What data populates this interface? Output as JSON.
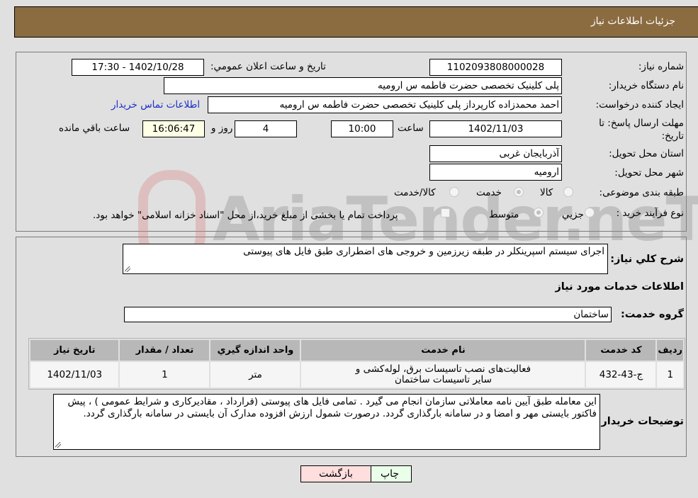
{
  "header": {
    "title": "جزئیات اطلاعات نیاز"
  },
  "fields": {
    "need_number": {
      "label": "شماره نیاز:",
      "value": "1102093808000028"
    },
    "announce_datetime": {
      "label": "تاریخ و ساعت اعلان عمومي:",
      "value": "1402/10/28 - 17:30"
    },
    "buyer_org": {
      "label": "نام دستگاه خريدار:",
      "value": "پلی کلینیک تخصصی حضرت فاطمه  س  ارومیه"
    },
    "requester": {
      "label": "ايجاد کننده درخواست:",
      "value": "احمد محمدزاده کارپرداز پلی کلینیک تخصصی حضرت فاطمه  س  ارومیه"
    },
    "buyer_contact_link": "اطلاعات تماس خریدار",
    "deadline": {
      "label": "مهلت ارسال پاسخ: تا تاریخ:",
      "date": "1402/11/03",
      "time_label": "ساعت",
      "time": "10:00",
      "days": "4",
      "days_label": "روز و",
      "remaining": "16:06:47",
      "remaining_label": "ساعت باقي مانده"
    },
    "province": {
      "label": "استان محل تحویل:",
      "value": "آذربایجان غربی"
    },
    "city": {
      "label": "شهر محل تحویل:",
      "value": "ارومیه"
    },
    "category": {
      "label": "طبقه بندی موضوعی:",
      "options": [
        "کالا",
        "خدمت",
        "کالا/خدمت"
      ],
      "selected": "خدمت"
    },
    "purchase_type": {
      "label": "نوع فرآیند خرید :",
      "options": [
        "جزيي",
        "متوسط"
      ],
      "selected": "متوسط",
      "treasury_note": "پرداخت تمام یا بخشی از مبلغ خرید،از محل \"اسناد خزانه اسلامی\" خواهد بود.",
      "treasury_checked": false
    }
  },
  "description": {
    "label": "شرح کلي نياز:",
    "value": "اجرای سیستم اسپرینکلر در طبقه زیرزمین و خروجی های اضطراری طبق فایل های پیوستی"
  },
  "services_section": {
    "title": "اطلاعات خدمات مورد نياز",
    "group_label": "گروه خدمت:",
    "group_value": "ساختمان",
    "table": {
      "headers": [
        "رديف",
        "کد خدمت",
        "نام خدمت",
        "واحد اندازه گيري",
        "تعداد / مقدار",
        "تاريخ نياز"
      ],
      "rows": [
        [
          "1",
          "ج-43-432",
          "فعالیت‌های نصب تاسیسات برق، لوله‌کشی و سایر تاسیسات ساختمان",
          "متر",
          "1",
          "1402/11/03"
        ]
      ]
    }
  },
  "buyer_notes": {
    "label": "توضيحات خريدار:",
    "value": "این معامله طبق آیین نامه معاملاتی سازمان انجام می گیرد . تمامی فایل های پیوستی (قرارداد ، مقادیرکاری و شرایط عمومی ) ، پیش فاکتور بایستی مهر و امضا و در سامانه بارگذاری گردد. درصورت شمول ارزش افزوده مدارک آن بایستی در سامانه بارگذاری گردد."
  },
  "buttons": {
    "print": "چاپ",
    "back": "بازگشت"
  },
  "watermark": "AriaTender.neT"
}
